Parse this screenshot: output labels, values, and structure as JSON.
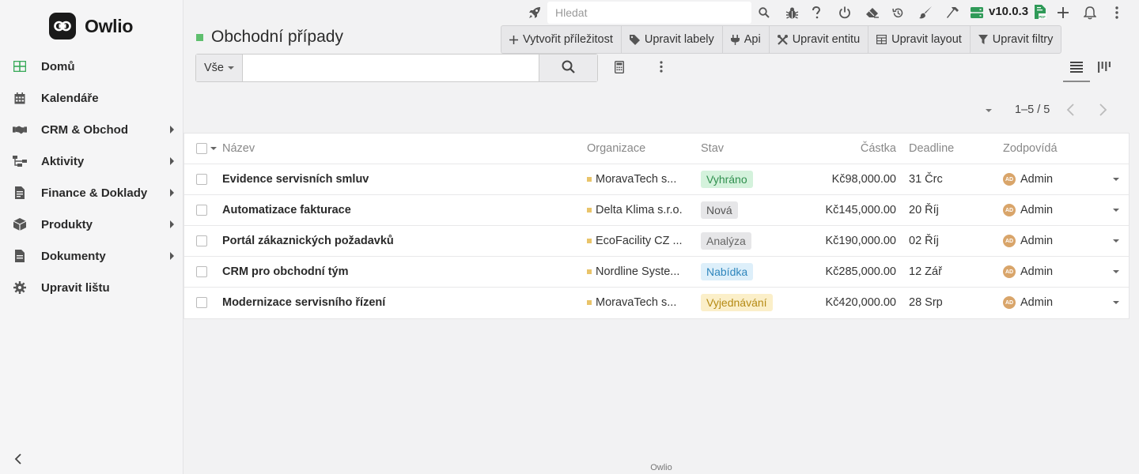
{
  "app": {
    "name": "Owlio",
    "footer": "Owlio",
    "version": "v10.0.3"
  },
  "colors": {
    "accent": "#5fbf6e",
    "org_marker": "#e9c46a",
    "avatar": "#d9a56a"
  },
  "sidebar": {
    "items": [
      {
        "label": "Domů",
        "icon": "home-grid-icon",
        "has_submenu": false
      },
      {
        "label": "Kalendáře",
        "icon": "calendar-icon",
        "has_submenu": false
      },
      {
        "label": "CRM & Obchod",
        "icon": "handshake-icon",
        "has_submenu": true
      },
      {
        "label": "Aktivity",
        "icon": "sitemap-icon",
        "has_submenu": true
      },
      {
        "label": "Finance & Doklady",
        "icon": "invoice-icon",
        "has_submenu": true
      },
      {
        "label": "Produkty",
        "icon": "box-icon",
        "has_submenu": true
      },
      {
        "label": "Dokumenty",
        "icon": "document-icon",
        "has_submenu": true
      },
      {
        "label": "Upravit lištu",
        "icon": "gear-icon",
        "has_submenu": false
      }
    ]
  },
  "topbar": {
    "search_placeholder": "Hledat"
  },
  "page": {
    "title": "Obchodní případy"
  },
  "actions": [
    {
      "label": "Vytvořit příležitost",
      "icon": "plus-icon"
    },
    {
      "label": "Upravit labely",
      "icon": "tag-icon"
    },
    {
      "label": "Api",
      "icon": "plug-icon"
    },
    {
      "label": "Upravit entitu",
      "icon": "tools-icon"
    },
    {
      "label": "Upravit layout",
      "icon": "table-icon"
    },
    {
      "label": "Upravit filtry",
      "icon": "filter-icon"
    }
  ],
  "filter": {
    "scope": "Vše",
    "value": ""
  },
  "pagination": {
    "text": "1–5 / 5"
  },
  "table": {
    "headers": {
      "name": "Název",
      "organization": "Organizace",
      "status": "Stav",
      "amount": "Částka",
      "deadline": "Deadline",
      "owner": "Zodpovídá"
    },
    "rows": [
      {
        "name": "Evidence servisních smluv",
        "organization": "MoravaTech s...",
        "status": "Vyhráno",
        "status_bg": "#d4f2dc",
        "status_fg": "#2f8f4e",
        "amount": "Kč98,000.00",
        "deadline": "31 Črc",
        "owner": "Admin",
        "owner_initials": "AD"
      },
      {
        "name": "Automatizace fakturace",
        "organization": "Delta Klima s.r.o.",
        "status": "Nová",
        "status_bg": "#e6e6e8",
        "status_fg": "#555555",
        "amount": "Kč145,000.00",
        "deadline": "20 Říj",
        "owner": "Admin",
        "owner_initials": "AD"
      },
      {
        "name": "Portál zákaznických požadavků",
        "organization": "EcoFacility CZ ...",
        "status": "Analýza",
        "status_bg": "#e6e6e8",
        "status_fg": "#666666",
        "amount": "Kč190,000.00",
        "deadline": "02 Říj",
        "owner": "Admin",
        "owner_initials": "AD"
      },
      {
        "name": "CRM pro obchodní tým",
        "organization": "Nordline Syste...",
        "status": "Nabídka",
        "status_bg": "#ddeffa",
        "status_fg": "#2f86bd",
        "amount": "Kč285,000.00",
        "deadline": "12 Zář",
        "owner": "Admin",
        "owner_initials": "AD"
      },
      {
        "name": "Modernizace servisního řízení",
        "organization": "MoravaTech s...",
        "status": "Vyjednávání",
        "status_bg": "#fbefc9",
        "status_fg": "#b58a14",
        "amount": "Kč420,000.00",
        "deadline": "28 Srp",
        "owner": "Admin",
        "owner_initials": "AD"
      }
    ]
  }
}
